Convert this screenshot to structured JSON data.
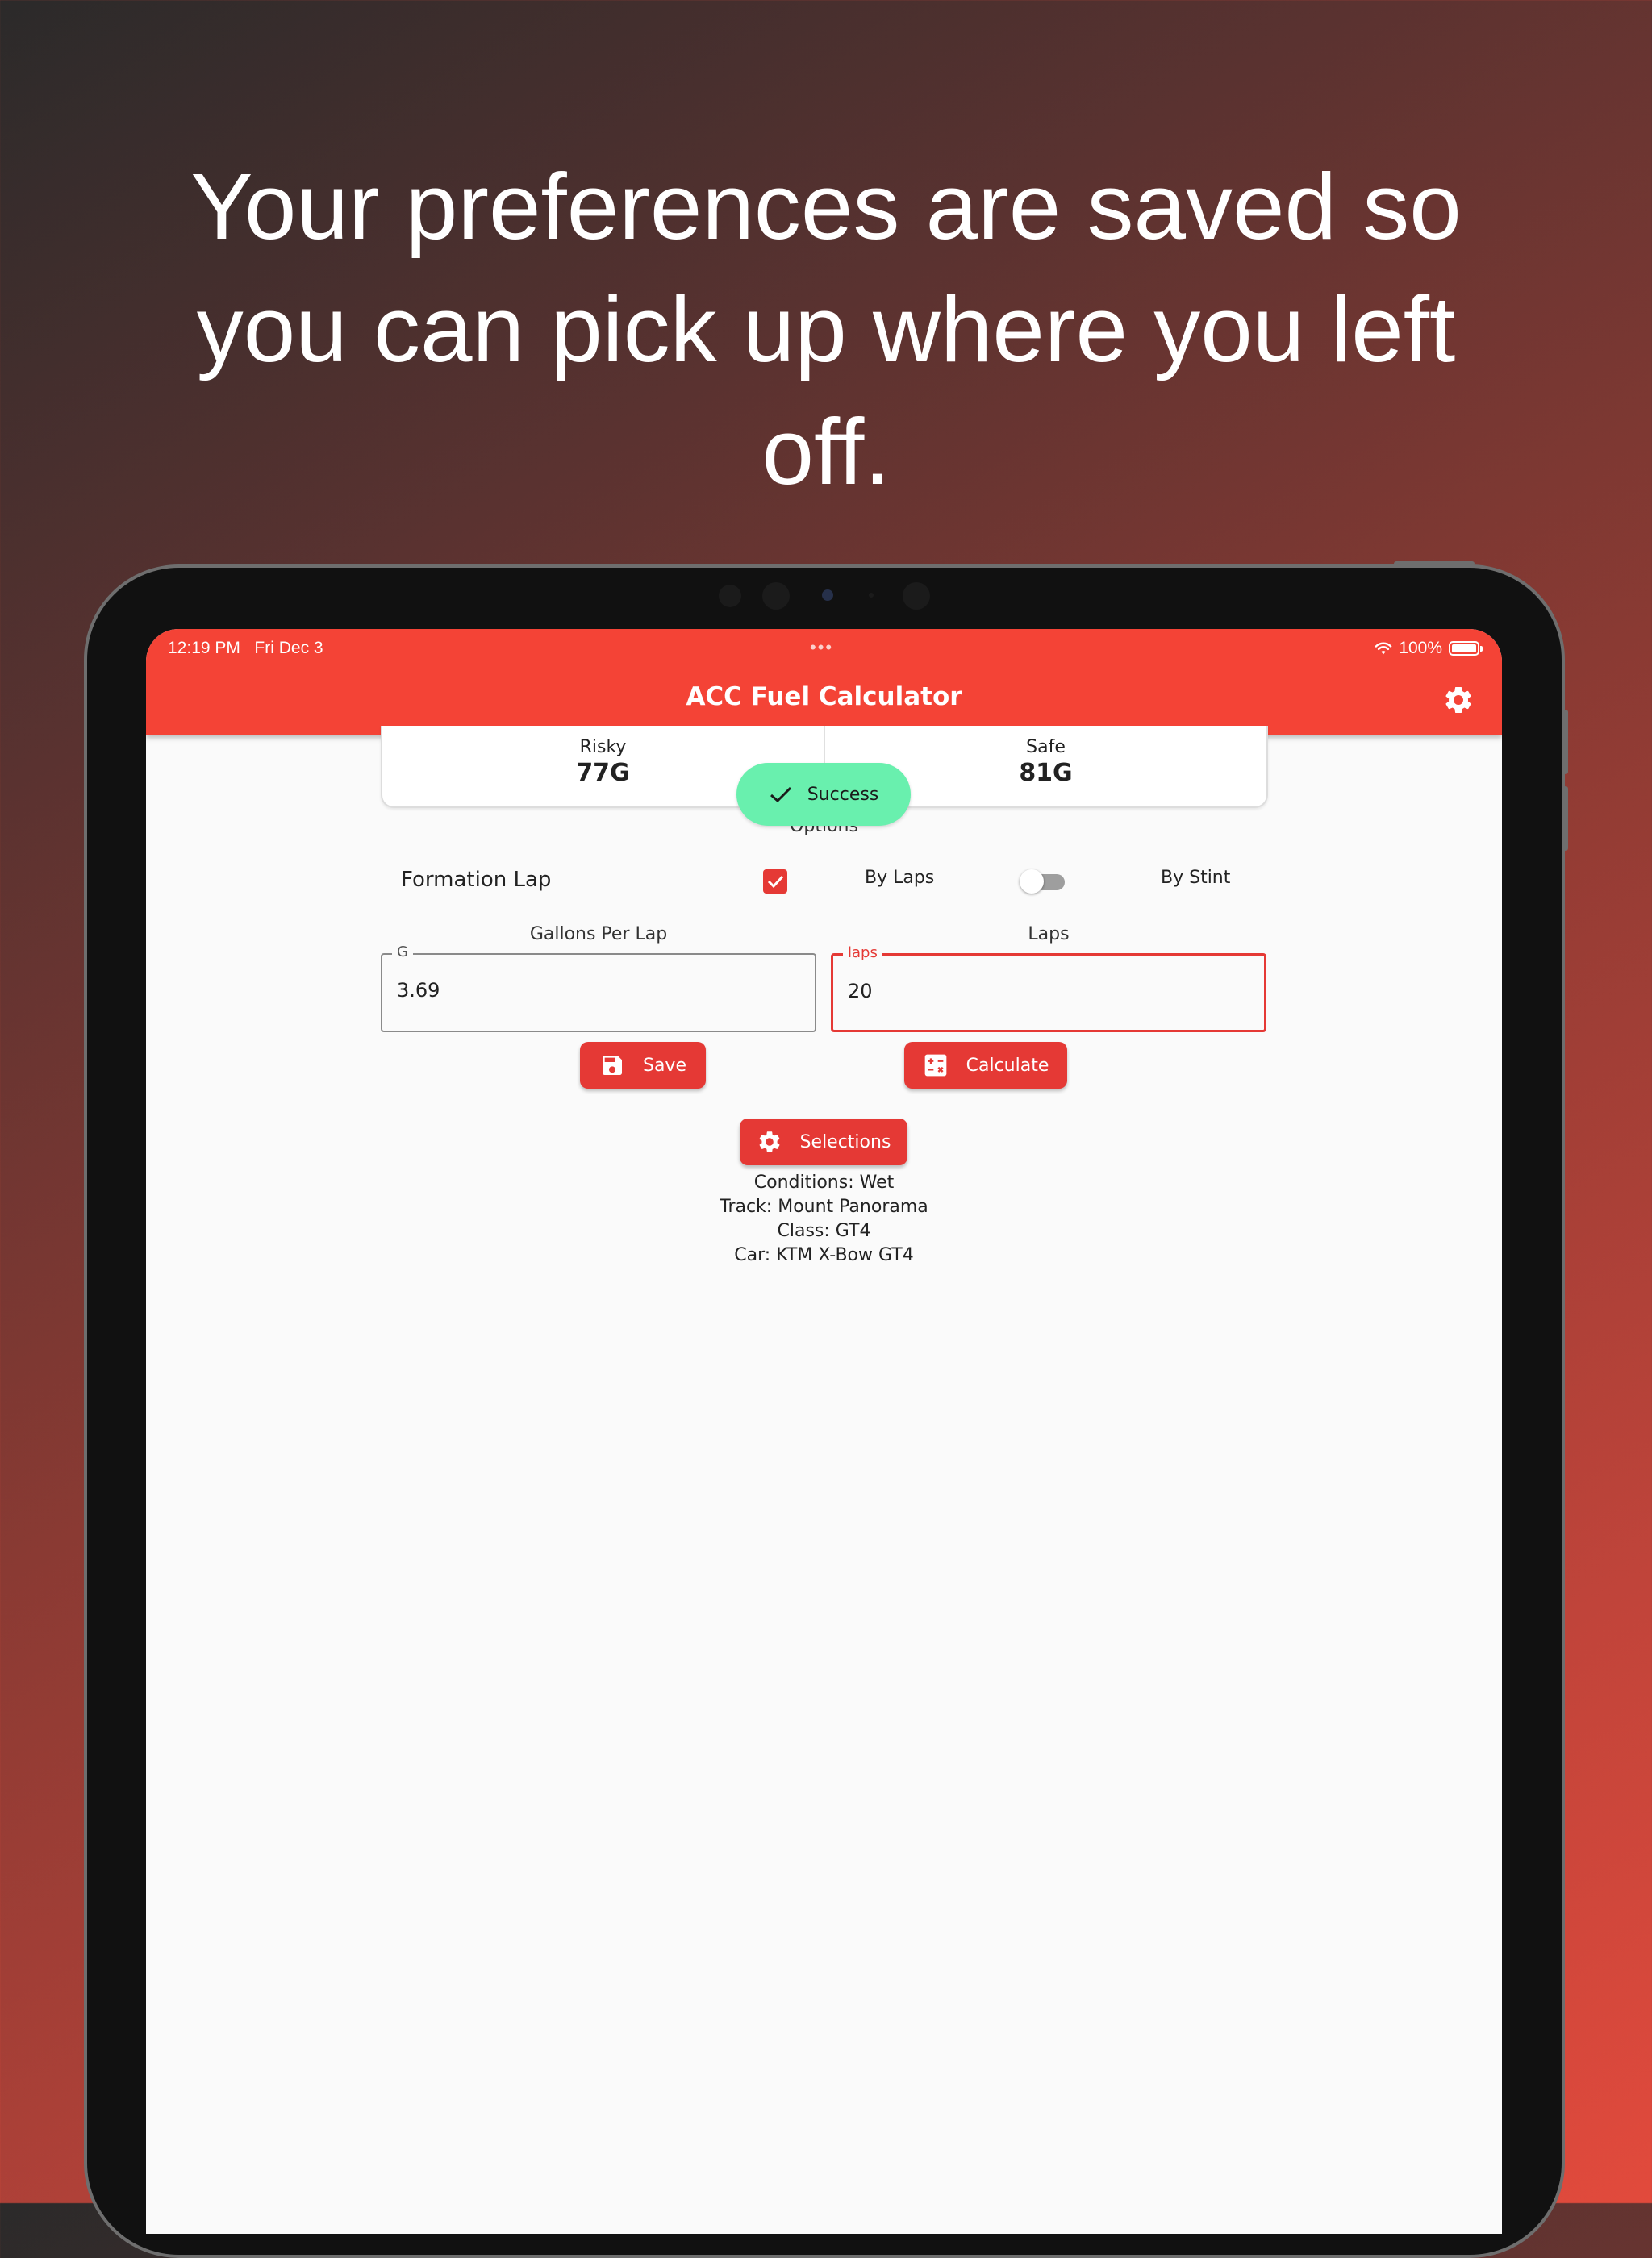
{
  "headline": "Your preferences are saved so you can pick up where you left off.",
  "status_bar": {
    "time": "12:19 PM",
    "date": "Fri Dec 3",
    "battery": "100%"
  },
  "app": {
    "title": "ACC Fuel Calculator"
  },
  "results": {
    "risky_label": "Risky",
    "risky_value": "77G",
    "safe_label": "Safe",
    "safe_value": "81G"
  },
  "toast": {
    "message": "Success"
  },
  "options": {
    "label": "Options",
    "formation_lap_label": "Formation Lap",
    "formation_lap_checked": true,
    "mode_left_label": "By Laps",
    "mode_right_label": "By Stint",
    "mode_toggle_on": false
  },
  "fields": {
    "gallons_title": "Gallons Per Lap",
    "gallons_legend": "G",
    "gallons_value": "3.69",
    "laps_title": "Laps",
    "laps_legend": "laps",
    "laps_value": "20"
  },
  "buttons": {
    "save": "Save",
    "calculate": "Calculate",
    "selections": "Selections"
  },
  "selections_info": {
    "conditions": "Conditions: Wet",
    "track": "Track: Mount Panorama",
    "class": "Class: GT4",
    "car": "Car: KTM X-Bow GT4"
  },
  "colors": {
    "primary": "#f44336",
    "button": "#e53935",
    "toast": "#69f0ae"
  },
  "icons": [
    "wifi-icon",
    "battery-icon",
    "gear-icon",
    "check-icon",
    "floppy-disk-icon",
    "calculator-icon"
  ]
}
